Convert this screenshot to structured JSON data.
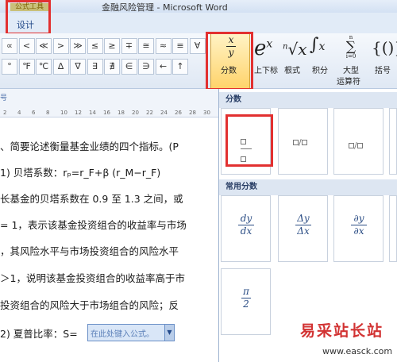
{
  "window": {
    "title": "金融风险管理 - Microsoft Word",
    "context_tab_top": "公式工具",
    "design_tab": "设计"
  },
  "ribbon": {
    "symbols_row1": [
      "±",
      "∞",
      "=",
      "≠",
      "~",
      "×",
      "÷",
      "!",
      "∝",
      "<",
      "≪",
      ">",
      "≫",
      "≤",
      "≥",
      "∓",
      "≅",
      "≈",
      "≡",
      "∀"
    ],
    "symbols_row2": [
      "∁",
      "∂",
      "√",
      "∛",
      "∜",
      "∪",
      "∩",
      "∅",
      "%",
      "°",
      "℉",
      "℃",
      "∆",
      "∇",
      "∃",
      "∄",
      "∈",
      "∋",
      "←",
      "↑"
    ],
    "fraction_label": "分数",
    "script_label": "上下标",
    "radical_label": "根式",
    "integral_label": "积分",
    "large_op_label_1": "大型",
    "large_op_label_2": "运算符",
    "bracket_label": "括号",
    "big_op_index": "i=0",
    "big_op_top": "n"
  },
  "ruler": {
    "label": "号",
    "numbers": [
      "2",
      "4",
      "6",
      "8",
      "10",
      "12",
      "14",
      "16",
      "18",
      "20",
      "22",
      "24",
      "26",
      "28",
      "30"
    ]
  },
  "document": {
    "lines": [
      "、简要论述衡量基金业绩的四个指标。(P",
      "1) 贝塔系数：rₚ=r_F+β (r_M−r_F)",
      "长基金的贝塔系数在 0.9 至 1.3 之间，或",
      "= 1，表示该基金投资组合的收益率与市场",
      "，其风险水平与市场投资组合的风险水平",
      "＞1，说明该基金投资组合的收益率高于市",
      "投资组合的风险大于市场组合的风险；反",
      "2) 夏普比率：S="
    ],
    "equation_placeholder": "在此处键入公式。"
  },
  "gallery": {
    "section1": "分数",
    "section2": "常用分数",
    "common": [
      {
        "num": "dy",
        "den": "dx"
      },
      {
        "num": "Δy",
        "den": "Δx"
      },
      {
        "num": "∂y",
        "den": "∂x"
      },
      {
        "num": "π",
        "den": "2"
      }
    ]
  },
  "watermark": {
    "brand": "易采站长站",
    "url": "www.easck.com"
  },
  "colors": {
    "highlight_red": "#e23030",
    "fraction_button": "#ffd36b",
    "ribbon_blue": "#dfe8f4"
  }
}
